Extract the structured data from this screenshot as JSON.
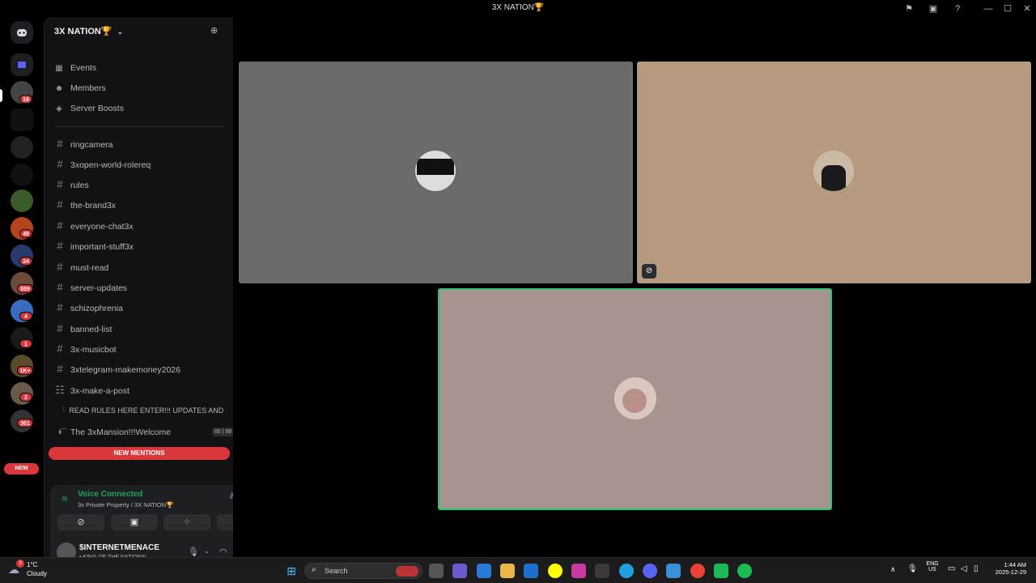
{
  "window": {
    "title": "3X NATION🏆"
  },
  "titlebar": {
    "inbox_icon": "inbox-icon",
    "help_icon": "help-icon",
    "minimize": "—",
    "maximize": "☐",
    "close": "✕"
  },
  "rail": {
    "badges": [
      "18",
      "48",
      "24",
      "559",
      "4",
      "1",
      "1K+",
      "2",
      "301"
    ],
    "new_label": "NEW"
  },
  "server": {
    "name": "3X NATION🏆",
    "menu": [
      {
        "label": "Events",
        "icon": "calendar-icon"
      },
      {
        "label": "Members",
        "icon": "members-icon"
      },
      {
        "label": "Server Boosts",
        "icon": "boost-icon"
      }
    ],
    "channels": [
      "ringcamera",
      "3xopen-world-rolereq",
      "rules",
      "the-brand3x",
      "everyone-chat3x",
      "important-stuff3x",
      "must-read",
      "server-updates",
      "schizophrenia",
      "banned-list",
      "3x-musicbot"
    ],
    "channel_telegram": "3xtelegram-makemoney2026",
    "forum_channel": "3x-make-a-post",
    "thread": "READ RULES HERE ENTER!!! UPDATES AND ...",
    "voice_channel": "The 3xMansion!!!Welcome",
    "voice_counts": [
      "00",
      "99"
    ],
    "new_mentions": "NEW MENTIONS"
  },
  "voice": {
    "status": "Voice Connected",
    "location": "3x Private Property / 3X NATION🏆"
  },
  "user": {
    "name": "$INTERNETMENACE",
    "status": "• KING OF THE NATION!!!"
  },
  "taskbar": {
    "weather_temp": "1°C",
    "weather_desc": "Cloudy",
    "weather_badge": "3",
    "search_placeholder": "Search",
    "lang_top": "ENG",
    "lang_bottom": "US",
    "time": "1:44 AM",
    "date": "2025-12-29"
  },
  "colors": {
    "accent_red": "#da373c",
    "voice_green": "#23a55a",
    "speaking_outline": "#2dc770",
    "tile1": "#6b6b6b",
    "tile2": "#b59a80",
    "tile3": "#a6948e"
  }
}
